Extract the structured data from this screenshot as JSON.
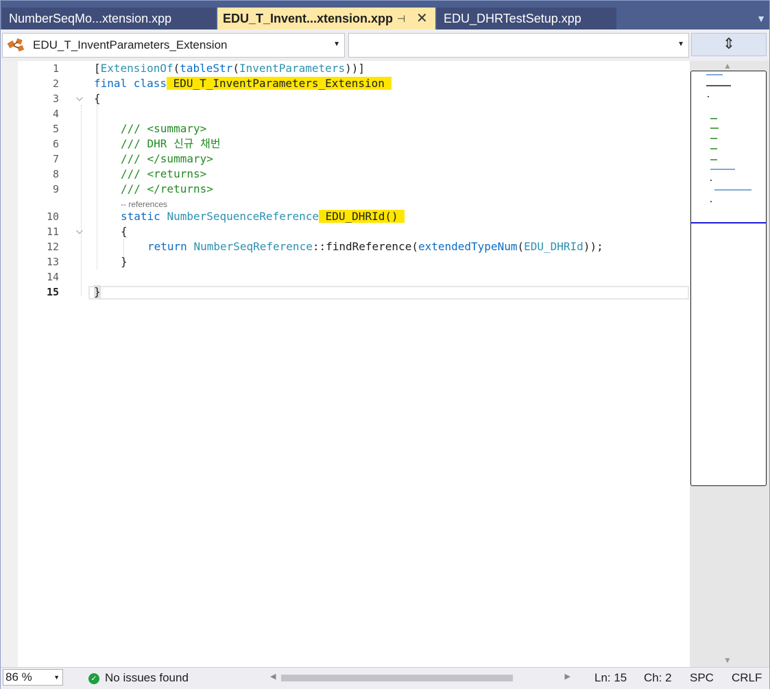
{
  "tabs": [
    {
      "label": "NumberSeqMo...xtension.xpp",
      "active": false
    },
    {
      "label": "EDU_T_Invent...xtension.xpp",
      "active": true,
      "pin_icon": "pin-icon",
      "close_icon": "close-icon"
    },
    {
      "label": "EDU_DHRTestSetup.xpp",
      "active": false
    }
  ],
  "navbar": {
    "class_combo": "EDU_T_InventParameters_Extension",
    "member_combo": "",
    "split_icon": "split-view-icon"
  },
  "editor": {
    "line_numbers": [
      "1",
      "2",
      "3",
      "4",
      "5",
      "6",
      "7",
      "8",
      "9",
      "10",
      "11",
      "12",
      "13",
      "14",
      "15"
    ],
    "current_line": "15",
    "codelens": "-- references",
    "lines": {
      "l1": {
        "open": "[",
        "attr": "ExtensionOf",
        "p1": "(",
        "fn": "tableStr",
        "p2": "(",
        "ty": "InventParameters",
        "close": "))]"
      },
      "l2": {
        "kw": "final class",
        "name": "EDU_T_InventParameters_Extension"
      },
      "l3": "{",
      "l5": "/// <summary>",
      "l6": "/// DHR 신규 채번",
      "l7": "/// </summary>",
      "l8": "/// <returns>",
      "l9": "/// </returns>",
      "l10": {
        "kw": "static",
        "ty": "NumberSequenceReference",
        "name": "EDU_DHRId()"
      },
      "l11": "{",
      "l12": {
        "kw": "return",
        "ty": "NumberSeqReference",
        "sep": "::",
        "call": "findReference",
        "p1": "(",
        "fn": "extendedTypeNum",
        "p2": "(",
        "arg": "EDU_DHRId",
        "close": "));"
      },
      "l13": "}",
      "l15": "}"
    }
  },
  "status": {
    "zoom": "86 %",
    "issues": "No issues found",
    "line": "Ln: 15",
    "char": "Ch: 2",
    "spc": "SPC",
    "eol": "CRLF"
  },
  "colors": {
    "keyword": "#0b6cc6",
    "type": "#2b91af",
    "comment": "#228b22",
    "highlight": "#ffe600",
    "active_tab": "#ffe8a6"
  }
}
